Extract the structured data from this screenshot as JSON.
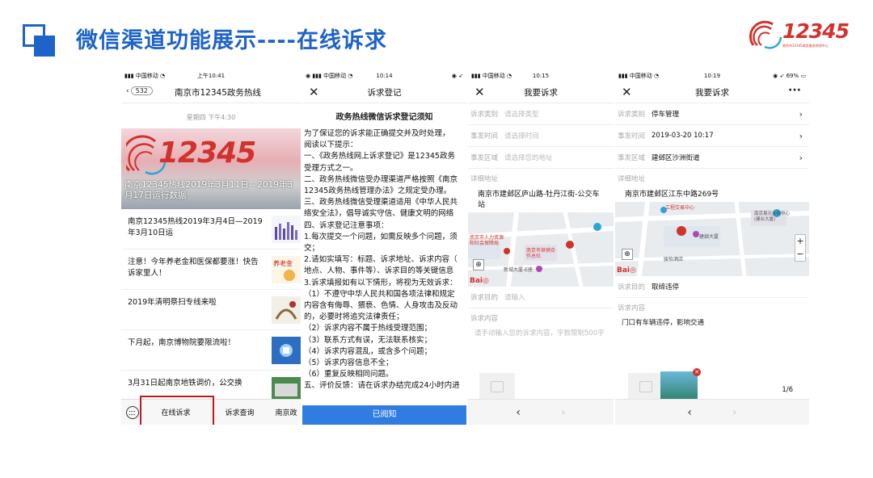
{
  "slide": {
    "title": "微信渠道功能展示----在线诉求",
    "logo_number": "12345",
    "logo_subtitle": "南京市12345政务服务热线中心"
  },
  "phone1": {
    "status": {
      "carrier": "中国移动",
      "time": "上午10:41"
    },
    "back_count": "532",
    "title": "南京市12345政务热线",
    "date": "星期四 下午4:30",
    "banner_number": "12345",
    "banner_caption": "南京12345热线2019年3月11日—2019年3月17日运行数据",
    "news": [
      {
        "title": "南京12345热线2019年3月4日—2019年3月10日运"
      },
      {
        "title": "注意！今年养老金和医保都要涨！快告诉家里人！"
      },
      {
        "title": "2019年清明祭扫专线来啦"
      },
      {
        "title": "下月起，南京博物院要限流啦！"
      },
      {
        "title": "3月31日起南京地铁调价，公交换"
      }
    ],
    "menu": [
      "在线诉求",
      "诉求查询",
      "南京政"
    ]
  },
  "phone2": {
    "status": {
      "carrier": "中国移动",
      "time": "10:14"
    },
    "title": "诉求登记",
    "notice_title": "政务热线微信诉求登记须知",
    "lines": [
      "为了保证您的诉求能正确提交并及时处理，",
      "阅读以下提示：",
      "一、《政务热线网上诉求登记》是12345政务",
      "受理方式之一。",
      "二、政务热线微信受办理渠道严格按照《南京",
      "12345政务热线管理办法》之规定受办理。",
      "三、政务热线微信受理渠道适用《中华人民共",
      "络安全法》，倡导诚实守信、健康文明的网络",
      "四、诉求登记注意事项：",
      "1.每次提交一个问题，如需反映多个问题，须",
      "交；",
      "2.请如实填写：标题、诉求地址、诉求内容（",
      "地点、人物、事件等）、诉求目的等关键信息",
      "3.诉求填报如有以下情形，将视为无效诉求：",
      "（1）不遵守中华人民共和国各项法律和规定",
      "内容含有侮辱、猥亵、色情、人身攻击及反动",
      "的，必要时将追究法律责任；",
      "（2）诉求内容不属于热线受理范围；",
      "（3）联系方式有误，无法联系核实；",
      "（4）诉求内容混乱，或含多个问题；",
      "（5）诉求内容信息不全；",
      "（6）重复反映相同问题。",
      "五、评价反馈：请在诉求办结完成24小时内进"
    ],
    "button": "已阅知"
  },
  "phone3": {
    "status": {
      "carrier": "中国移动",
      "time": "10:15"
    },
    "title": "我要诉求",
    "rows": [
      {
        "label": "诉求类别",
        "value": "请选择类型"
      },
      {
        "label": "事发时间",
        "value": "请选择时间"
      },
      {
        "label": "事发区域",
        "value": "请选择您的地址"
      }
    ],
    "addr_label": "详细地址",
    "address": "南京市建邺区庐山路-牡丹江街-公交车站",
    "map_labels": [
      "南京市人力资源和社会保障局",
      "南京市供销合作总社",
      "新城大厦-E座"
    ],
    "purpose_label": "诉求目的",
    "purpose_placeholder": "请输入",
    "content_label": "诉求内容",
    "content_placeholder": "请手动输入您的诉求内容，字数限制500字",
    "nav": [
      "‹",
      "›"
    ]
  },
  "phone4": {
    "status": {
      "carrier": "中国移动",
      "time": "10:19",
      "battery": "69%"
    },
    "title": "我要诉求",
    "rows": [
      {
        "label": "诉求类别",
        "value": "停车管理"
      },
      {
        "label": "事发时间",
        "value": "2019-03-20 10:17"
      },
      {
        "label": "事发区域",
        "value": "建邺区沙洲街道"
      }
    ],
    "addr_label": "详细地址",
    "address": "南京市建邺区江东中路269号",
    "map_labels": [
      "工程交易中心",
      "南京易元金融中心(建业大厦)",
      "建邺大厦",
      "骏怡酒店"
    ],
    "purpose_label": "诉求目的",
    "purpose_value": "取缔违停",
    "content_label": "诉求内容",
    "content_value": "门口有车辆违停，影响交通",
    "page_count": "1/6",
    "nav": [
      "‹",
      "›"
    ]
  }
}
